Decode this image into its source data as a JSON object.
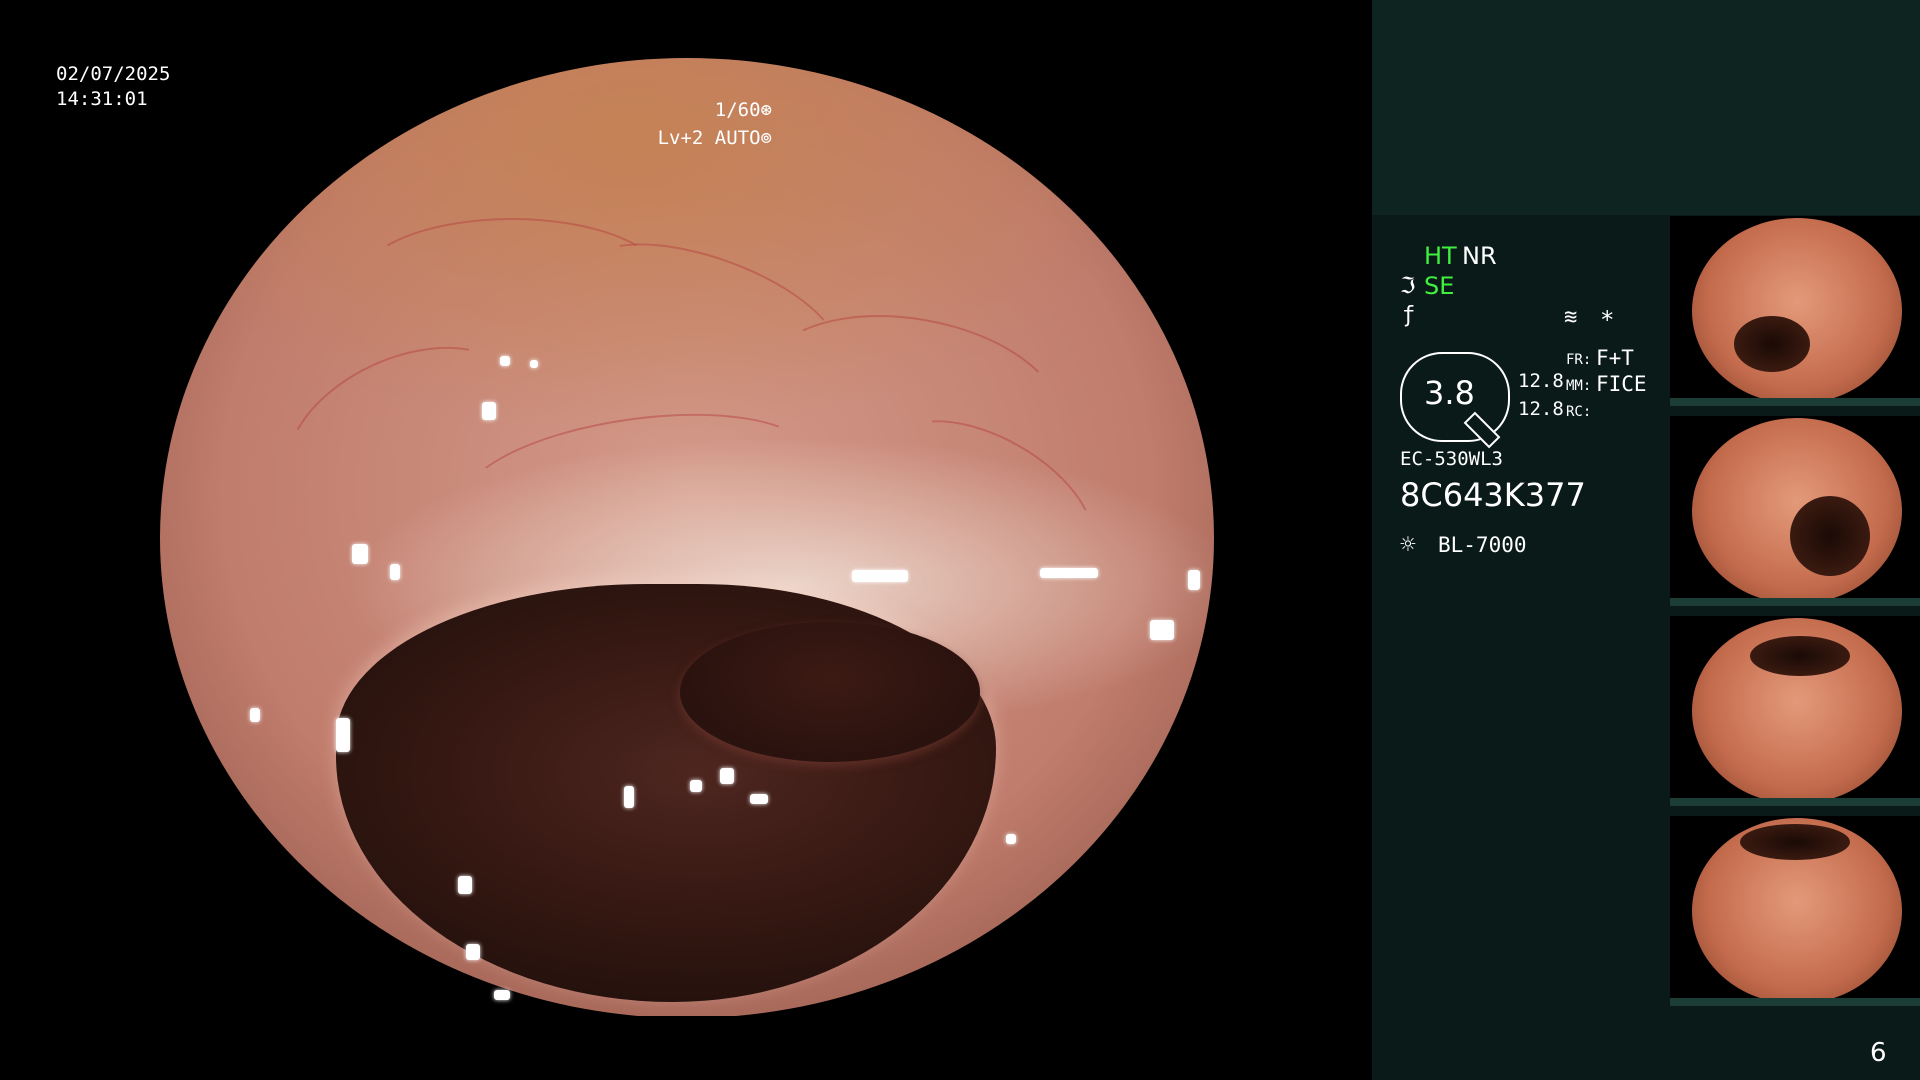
{
  "overlay": {
    "date": "02/07/2025",
    "time": "14:31:01",
    "shutter": "1/60⊛",
    "level": "Lv+2 AUTO⊚"
  },
  "settings": {
    "ht": "HT",
    "nr": "NR",
    "se": "SE",
    "gauge_value": "3.8",
    "value_1": "12.8",
    "value_2": "12.8",
    "fr_label": "FR:",
    "fr_value": "F+T",
    "mm_label": "MM:",
    "mm_value": "FICE",
    "rc_label": "RC:",
    "model": "EC-530WL3",
    "serial": "8C643K377",
    "light_source": "BL-7000"
  },
  "icons": {
    "se": "se-curve-icon",
    "f": "f-mode-icon",
    "wave": "wave-icon",
    "asterisk": "asterisk-icon",
    "light": "light-source-icon"
  },
  "thumbnails": [
    {
      "name": "thumbnail-1"
    },
    {
      "name": "thumbnail-2"
    },
    {
      "name": "thumbnail-3"
    },
    {
      "name": "thumbnail-4"
    }
  ],
  "page_number": "6",
  "colors": {
    "accent_green": "#3ff03f",
    "panel_bg": "#0a1a18",
    "panel_header": "#0e2420"
  }
}
